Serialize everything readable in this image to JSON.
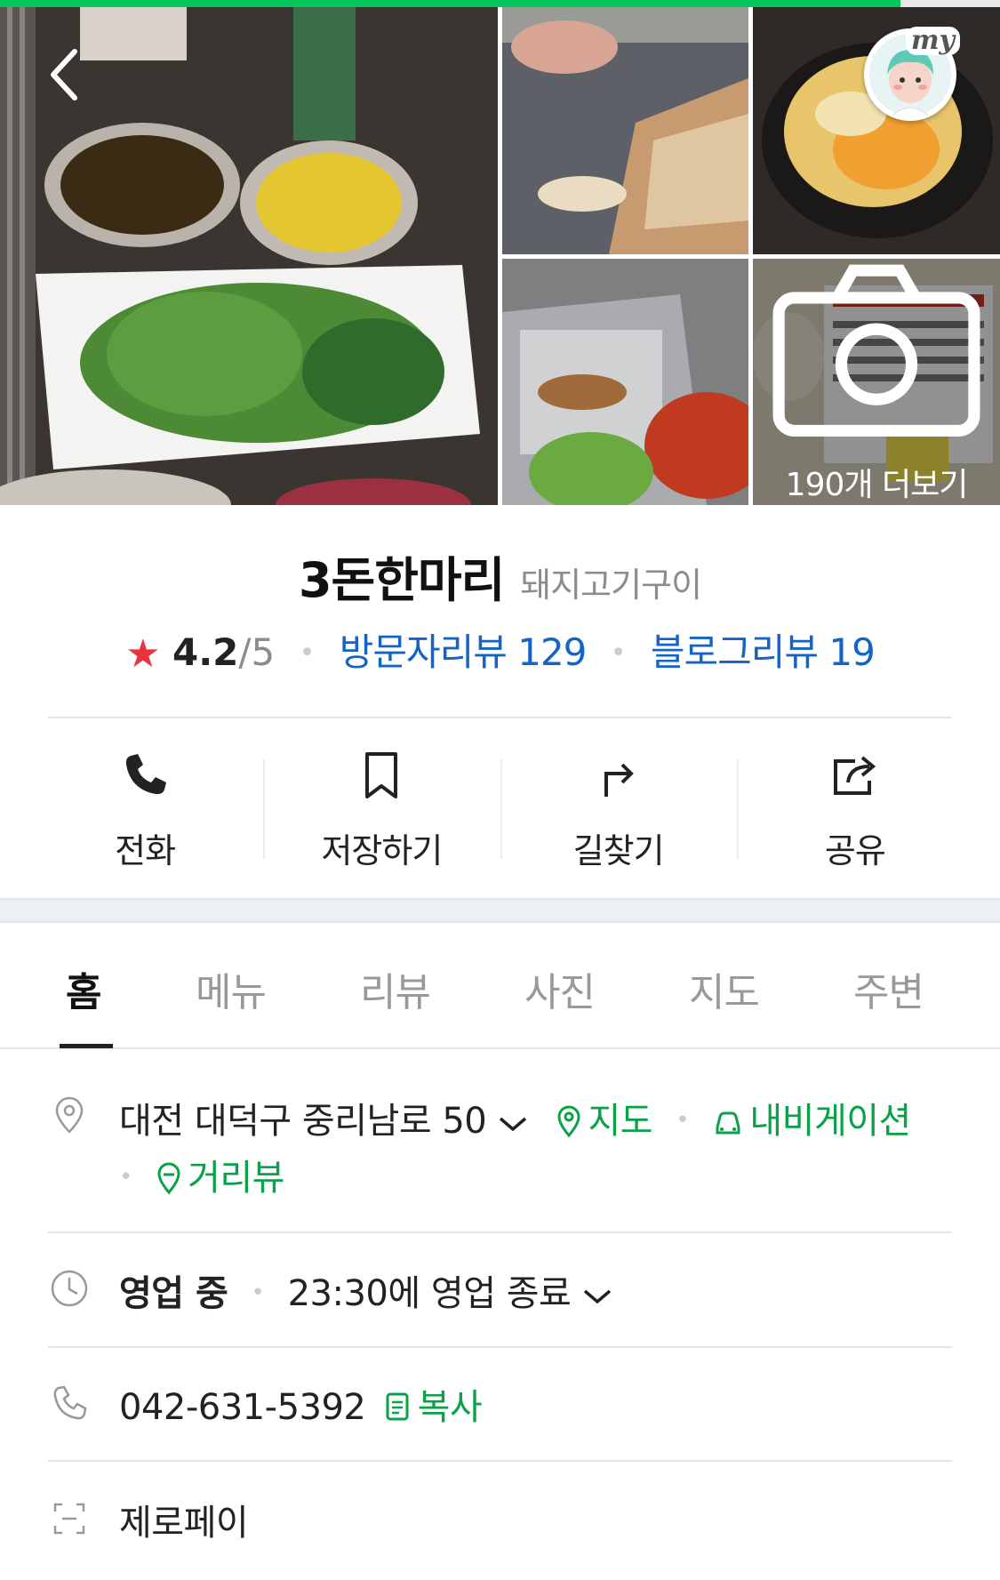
{
  "status_bar": {
    "progress_fraction": 0.9
  },
  "header": {
    "back_icon": "chevron-left-icon",
    "my_label": "my"
  },
  "photos": {
    "more_label": "190개 더보기"
  },
  "place": {
    "name": "3돈한마리",
    "category": "돼지고기구이",
    "rating": "4.2",
    "rating_max": "/5",
    "visitor_reviews": "방문자리뷰 129",
    "blog_reviews": "블로그리뷰 19"
  },
  "actions": [
    {
      "label": "전화",
      "icon": "phone-icon"
    },
    {
      "label": "저장하기",
      "icon": "bookmark-icon"
    },
    {
      "label": "길찾기",
      "icon": "directions-icon"
    },
    {
      "label": "공유",
      "icon": "share-icon"
    }
  ],
  "tabs": [
    {
      "label": "홈",
      "active": true
    },
    {
      "label": "메뉴"
    },
    {
      "label": "리뷰"
    },
    {
      "label": "사진"
    },
    {
      "label": "지도"
    },
    {
      "label": "주변"
    }
  ],
  "info": {
    "address": "대전 대덕구 중리남로 50",
    "map_link": "지도",
    "navigation_link": "내비게이션",
    "streetview_link": "거리뷰",
    "hours_status": "영업 중",
    "hours_detail": "23:30에 영업 종료",
    "phone": "042-631-5392",
    "copy_label": "복사",
    "zeropay": "제로페이"
  },
  "colors": {
    "accent_green": "#03c75a",
    "link_blue": "#1464c8",
    "star_red": "#e8343e"
  }
}
